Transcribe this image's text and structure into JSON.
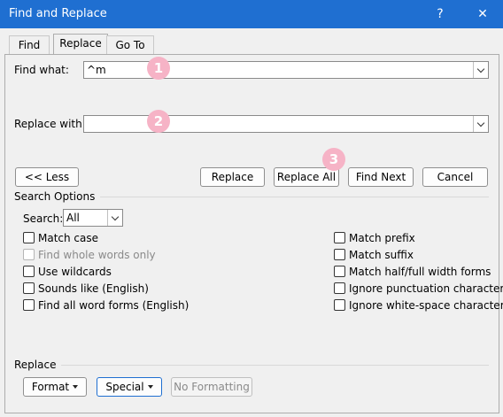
{
  "window": {
    "title": "Find and Replace",
    "help_glyph": "?",
    "close_glyph": "✕"
  },
  "tabs": [
    {
      "label": "Find"
    },
    {
      "label": "Replace"
    },
    {
      "label": "Go To"
    }
  ],
  "find": {
    "label": "Find what:",
    "value": "^m"
  },
  "replace": {
    "label": "Replace with:",
    "value": ""
  },
  "markers": [
    "1",
    "2",
    "3"
  ],
  "buttons": {
    "less": "<< Less",
    "replace": "Replace",
    "replace_all": "Replace All",
    "find_next": "Find Next",
    "cancel": "Cancel"
  },
  "search_options": {
    "heading": "Search Options",
    "search_label": "Search:",
    "search_value": "All",
    "left": [
      "Match case",
      "Find whole words only",
      "Use wildcards",
      "Sounds like (English)",
      "Find all word forms (English)"
    ],
    "right": [
      "Match prefix",
      "Match suffix",
      "Match half/full width forms",
      "Ignore punctuation characters",
      "Ignore white-space characters"
    ]
  },
  "replace_section": {
    "heading": "Replace",
    "format": "Format",
    "special": "Special",
    "no_formatting": "No Formatting"
  },
  "colors": {
    "titlebar": "#1f6fd1",
    "marker": "#f6b3c6"
  }
}
